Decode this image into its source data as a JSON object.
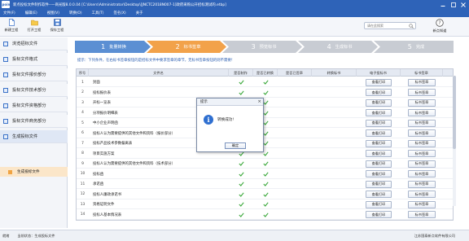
{
  "window": {
    "title": "新点投标文件制作软件--一商光版8.0.0.04   [C:\\Users\\Administrator\\Desktop\\[JNCTC2018N007-1]政府采购公开招标测试的.etbp]",
    "app_logo": "Epoint",
    "controls": [
      "minimize",
      "maximize",
      "close"
    ]
  },
  "menu": [
    "文件(F)",
    "编辑(E)",
    "视图(V)",
    "转换(O)",
    "工具(T)",
    "签名(X)",
    "关于"
  ],
  "toolbar": {
    "new": "新建工程",
    "open": "打开工程",
    "save": "保存工程",
    "search_placeholder": "请在此搜索",
    "help": "新点知道"
  },
  "sidebar": {
    "items": [
      "浏览招标文件",
      "投标文件格式",
      "投标文件报价部分",
      "投标文件技术部分",
      "投标文件资格部分",
      "投标文件商务部分",
      "生成投标文件"
    ],
    "sub_item": "生成投标文件"
  },
  "steps": [
    {
      "num": "1",
      "label": "批量转换"
    },
    {
      "num": "2",
      "label": "标书签章"
    },
    {
      "num": "3",
      "label": "预览标书"
    },
    {
      "num": "4",
      "label": "生成标书"
    },
    {
      "num": "5",
      "label": "完成"
    }
  ],
  "colors": {
    "step_done": "#5b8fd3",
    "step_active": "#f2a24a",
    "step_todo": "#c8ccd3",
    "check": "#3aa83a"
  },
  "hint": "提示：下列条件，在右标书签章按钮的是招标文件中要求签章的章节，无标书签章按钮的则不需要！",
  "grid": {
    "headers": [
      "序号",
      "文件名",
      "是否制作",
      "是否已转换",
      "是否已签章",
      "转换标书",
      "电子投标书",
      "标书签章"
    ],
    "rows": [
      {
        "idx": "1",
        "name": "封面",
        "made": true,
        "converted": true
      },
      {
        "idx": "2",
        "name": "投标报价表",
        "made": true,
        "converted": true
      },
      {
        "idx": "3",
        "name": "开标一览表",
        "made": true,
        "converted": true
      },
      {
        "idx": "4",
        "name": "分项报价明细表",
        "made": true,
        "converted": true
      },
      {
        "idx": "5",
        "name": "中小企业声明函",
        "made": true,
        "converted": true
      },
      {
        "idx": "6",
        "name": "投标人认为需要提供的其他文件和资料（报价部分）",
        "made": true,
        "converted": true
      },
      {
        "idx": "7",
        "name": "投标产品技术参数偏离表",
        "made": true,
        "converted": true
      },
      {
        "idx": "8",
        "name": "项目实施方案",
        "made": true,
        "converted": true
      },
      {
        "idx": "9",
        "name": "投标人认为需要提供的其他文件和资料（技术部分）",
        "made": true,
        "converted": true
      },
      {
        "idx": "10",
        "name": "投标函",
        "made": true,
        "converted": true
      },
      {
        "idx": "11",
        "name": "承诺函",
        "made": true,
        "converted": true
      },
      {
        "idx": "12",
        "name": "投标人廉政承诺书",
        "made": true,
        "converted": true
      },
      {
        "idx": "13",
        "name": "资格证明文件",
        "made": true,
        "converted": true
      },
      {
        "idx": "14",
        "name": "投标人基本情况表",
        "made": true,
        "converted": true
      }
    ],
    "view_button": "查看打印",
    "sign_button": "标书签章"
  },
  "dialog": {
    "title": "提示",
    "message": "转换成功!",
    "ok": "确定"
  },
  "status": {
    "ready": "就绪",
    "current_state_label": "当前状态：",
    "current_state_value": "生成投标文件",
    "company": "江苏国泰新点软件有限公司"
  }
}
